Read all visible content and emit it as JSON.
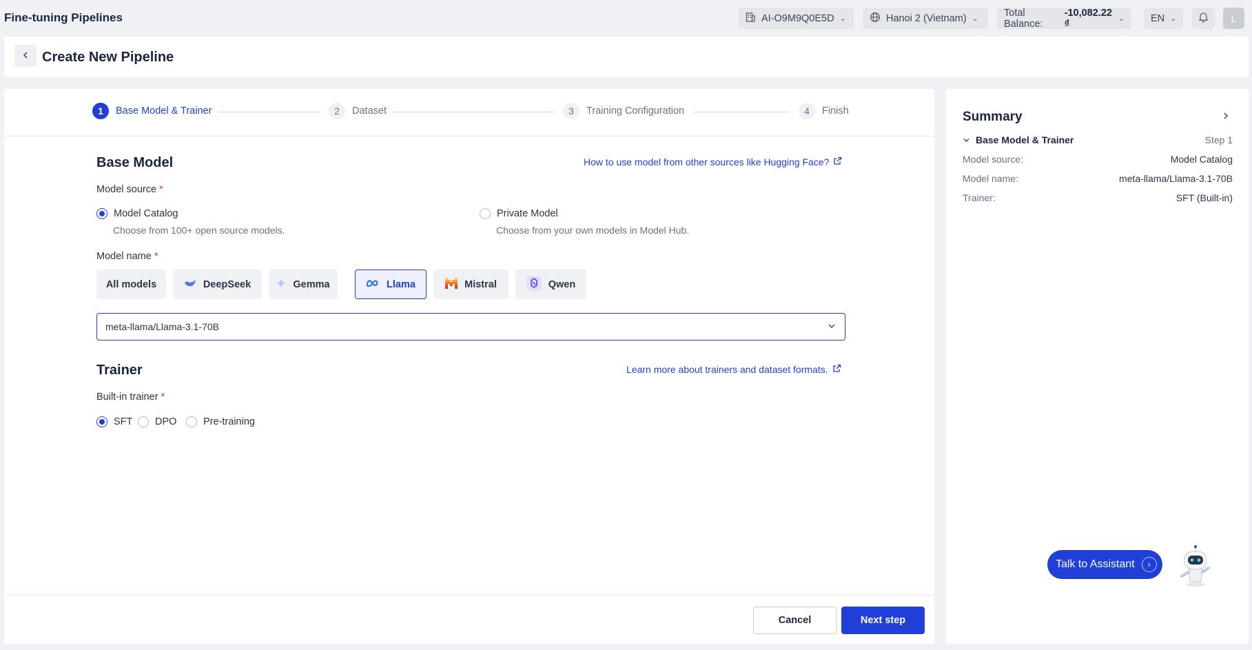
{
  "topbar": {
    "app_title": "Fine-tuning Pipelines",
    "project": "AI-O9M9Q0E5D",
    "region": "Hanoi 2 (Vietnam)",
    "balance_label": "Total Balance:",
    "balance_value": "-10,082.22 ₫",
    "language": "EN",
    "avatar_initial": "L"
  },
  "header": {
    "title": "Create New Pipeline"
  },
  "stepper": {
    "steps": [
      {
        "num": "1",
        "label": "Base Model & Trainer"
      },
      {
        "num": "2",
        "label": "Dataset"
      },
      {
        "num": "3",
        "label": "Training Configuration"
      },
      {
        "num": "4",
        "label": "Finish"
      }
    ]
  },
  "base_model": {
    "title": "Base Model",
    "help_link": "How to use model from other sources like Hugging Face?",
    "source_label": "Model source",
    "required_mark": "*",
    "source_options": [
      {
        "label": "Model Catalog",
        "desc": "Choose from 100+ open source models.",
        "checked": true
      },
      {
        "label": "Private Model",
        "desc": "Choose from your own models in Model Hub.",
        "checked": false
      }
    ],
    "name_label": "Model name",
    "chips": [
      "All models",
      "DeepSeek",
      "Gemma",
      "Llama",
      "Mistral",
      "Qwen"
    ],
    "active_chip": "Llama",
    "selected_model": "meta-llama/Llama-3.1-70B"
  },
  "trainer": {
    "title": "Trainer",
    "help_link": "Learn more about trainers and dataset formats.",
    "builtin_label": "Built-in trainer",
    "options": [
      "SFT",
      "DPO",
      "Pre-training"
    ],
    "selected": "SFT"
  },
  "footer": {
    "cancel": "Cancel",
    "next": "Next step"
  },
  "summary": {
    "title": "Summary",
    "section_title": "Base Model & Trainer",
    "section_step": "Step 1",
    "rows": [
      {
        "key": "Model source:",
        "value": "Model Catalog"
      },
      {
        "key": "Model name:",
        "value": "meta-llama/Llama-3.1-70B"
      },
      {
        "key": "Trainer:",
        "value": "SFT (Built-in)"
      }
    ]
  },
  "assistant": {
    "label": "Talk to Assistant"
  },
  "colors": {
    "accent": "#1f3fd6",
    "background": "#f0f1f4",
    "required": "#d93636"
  }
}
